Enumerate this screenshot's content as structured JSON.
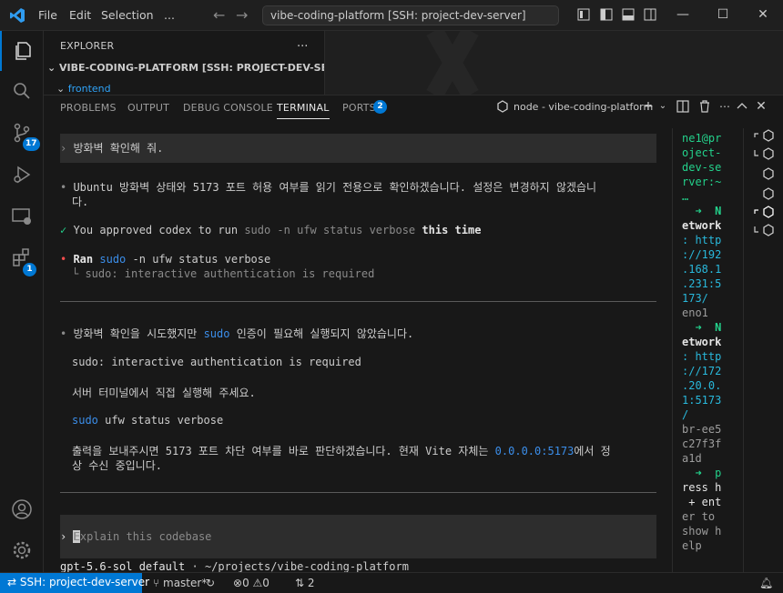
{
  "titlebar": {
    "menu": [
      "File",
      "Edit",
      "Selection",
      "..."
    ],
    "search_text": "vibe-coding-platform [SSH: project-dev-server]"
  },
  "activity": {
    "scm_badge": "17",
    "extensions_badge": "1"
  },
  "sidebar": {
    "title": "EXPLORER",
    "more": "...",
    "section": "VIBE-CODING-PLATFORM [SSH: PROJECT-DEV-SERVER]",
    "folder": "frontend"
  },
  "panel": {
    "tabs": [
      "PROBLEMS",
      "OUTPUT",
      "DEBUG CONSOLE",
      "TERMINAL",
      "PORTS"
    ],
    "ports_badge": "2",
    "terminal_name": "node - vibe-coding-platform"
  },
  "terminal": {
    "user_prompt": "방화벽 확인해 줘.",
    "assistant_intro_1": "Ubuntu 방화벽 상태와 5173 포트 허용 여부를 읽기 전용으로 확인하겠습니다. 설정은 변경하지 않겠습니",
    "assistant_intro_2": "다.",
    "approved_prefix": "You approved codex to run",
    "approved_cmd": "sudo -n ufw status verbose",
    "approved_suffix": "this time",
    "ran_label": "Ran",
    "ran_sudo": "sudo",
    "ran_cmd": "-n ufw status verbose",
    "ran_output": "└ sudo: interactive authentication is required",
    "result_1a": "방화벽 확인을 시도했지만",
    "result_1b": "sudo",
    "result_1c": "인증이 필요해 실행되지 않았습니다.",
    "result_2": "sudo: interactive authentication is required",
    "result_3": "서버 터미널에서 직접 실행해 주세요.",
    "result_4a": "sudo",
    "result_4b": "ufw status verbose",
    "result_5a": "출력을 보내주시면 5173 포트 차단 여부를 바로 판단하겠습니다. 현재 Vite 자체는",
    "result_5b": "0.0.0.0:5173",
    "result_5c": "에서 정",
    "result_6": "상 수신 중입니다.",
    "input_placeholder": "Explain this codebase",
    "model": "gpt-5.6-sol default",
    "path": "· ~/projects/vibe-coding-platform"
  },
  "right_terminal": {
    "lines": [
      "ne1@pr",
      "oject-",
      "dev-se",
      "rver:~",
      "…",
      "  ➜  N",
      "etwork",
      ": http",
      "://192",
      ".168.1",
      ".231:5",
      "173/",
      "eno1",
      "  ➜  N",
      "etwork",
      ": http",
      "://172",
      ".20.0.",
      "1:5173",
      "/",
      "br-ee5",
      "c27f3f",
      "a1d",
      "  ➜  p",
      "ress h",
      " + ent",
      "er to",
      "show h",
      "elp"
    ]
  },
  "statusbar": {
    "remote": "SSH: project-dev-server",
    "branch": "master*",
    "errors": "0",
    "warnings": "0",
    "ports": "2"
  },
  "colors": {
    "accent": "#0078d4",
    "green": "#23d18b",
    "blue": "#3b8eea"
  }
}
